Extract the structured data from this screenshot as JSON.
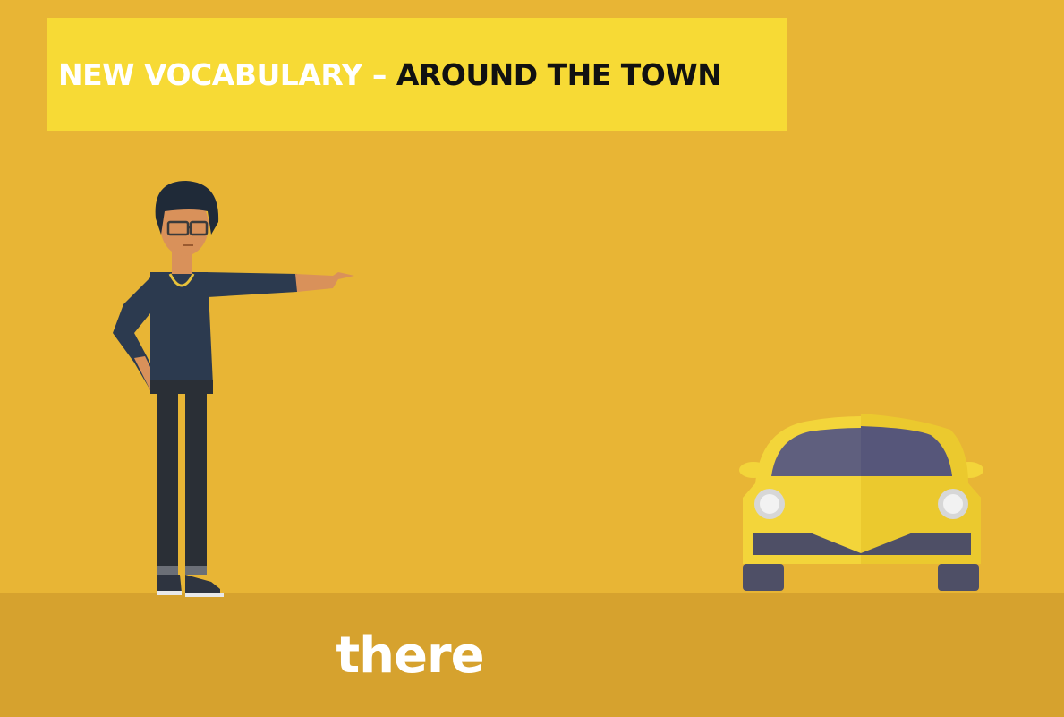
{
  "title": {
    "part1": "NEW VOCABULARY",
    "separator": " – ",
    "part2": "AROUND THE TOWN"
  },
  "word": "there",
  "colors": {
    "background": "#E8B535",
    "banner": "#F7DA35",
    "ground": "#D6A22E",
    "shirt": "#2C3A4F",
    "car": "#F3D53A"
  },
  "illustrations": {
    "person": "man-pointing-illustration",
    "car": "yellow-car-illustration"
  }
}
